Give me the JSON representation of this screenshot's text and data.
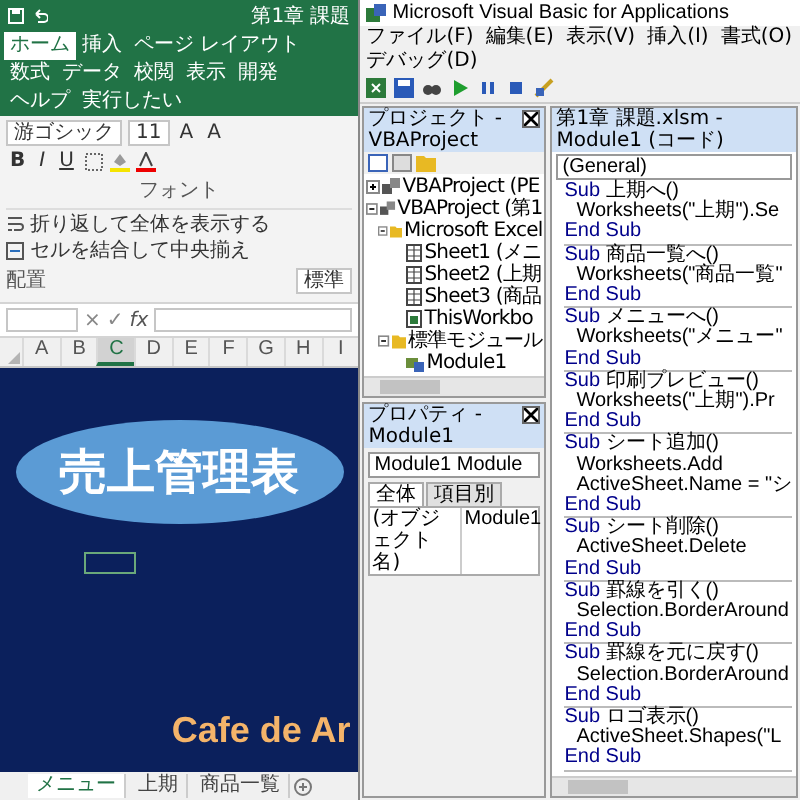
{
  "excel": {
    "title": "第1章 課題",
    "ribbon_tabs": [
      {
        "label": "ホーム",
        "selected": true
      },
      {
        "label": "挿入",
        "selected": false
      },
      {
        "label": "ページ レイアウト",
        "selected": false
      },
      {
        "label": "数式",
        "selected": false
      },
      {
        "label": "データ",
        "selected": false
      },
      {
        "label": "校閲",
        "selected": false
      },
      {
        "label": "表示",
        "selected": false
      },
      {
        "label": "開発",
        "selected": false
      },
      {
        "label": "ヘルプ",
        "selected": false
      },
      {
        "label": "実行したい",
        "selected": false
      }
    ],
    "font": {
      "name": "游ゴシック",
      "size": "11",
      "size_buttons": [
        "A",
        "A"
      ],
      "style_buttons": [
        "B",
        "I",
        "U"
      ],
      "label": "フォント"
    },
    "alignment": {
      "wrap_text": "折り返して全体を表示する",
      "merge_center": "セルを結合して中央揃え",
      "label": "配置"
    },
    "number_format": "標準",
    "formula_bar": {
      "cancel": "×",
      "enter": "✓",
      "function": "fx"
    },
    "columns": [
      {
        "label": "A",
        "selected": false
      },
      {
        "label": "B",
        "selected": false
      },
      {
        "label": "C",
        "selected": true
      },
      {
        "label": "D",
        "selected": false
      },
      {
        "label": "E",
        "selected": false
      },
      {
        "label": "F",
        "selected": false
      },
      {
        "label": "G",
        "selected": false
      },
      {
        "label": "H",
        "selected": false
      },
      {
        "label": "I",
        "selected": false
      }
    ],
    "sheet": {
      "title": "売上管理表",
      "brand": "Cafe de Ar"
    },
    "sheet_tabs": [
      {
        "label": "メニュー",
        "selected": true
      },
      {
        "label": "上期",
        "selected": false
      },
      {
        "label": "商品一覧",
        "selected": false
      }
    ]
  },
  "vbe": {
    "title": "Microsoft Visual Basic for Applications",
    "menu": [
      "ファイル(F)",
      "編集(E)",
      "表示(V)",
      "挿入(I)",
      "書式(O)",
      "デバッグ(D)"
    ],
    "project": {
      "title": "プロジェクト - VBAProject",
      "tree": [
        {
          "label": "VBAProject (PE",
          "kind": "project",
          "expanded": false
        },
        {
          "label": "VBAProject (第1",
          "kind": "project",
          "expanded": true,
          "children": [
            {
              "label": "Microsoft Excel",
              "kind": "folder",
              "expanded": true,
              "children": [
                {
                  "label": "Sheet1 (メニ",
                  "kind": "sheet"
                },
                {
                  "label": "Sheet2 (上期",
                  "kind": "sheet"
                },
                {
                  "label": "Sheet3 (商品",
                  "kind": "sheet"
                },
                {
                  "label": "ThisWorkbo",
                  "kind": "workbook"
                }
              ]
            },
            {
              "label": "標準モジュール",
              "kind": "folder",
              "expanded": true,
              "children": [
                {
                  "label": "Module1",
                  "kind": "module"
                }
              ]
            }
          ]
        }
      ]
    },
    "properties": {
      "title": "プロパティ - Module1",
      "object": "Module1 Module",
      "tabs": [
        {
          "label": "全体",
          "selected": true
        },
        {
          "label": "項目別",
          "selected": false
        }
      ],
      "rows": [
        {
          "name": "(オブジェクト名)",
          "value": "Module1"
        }
      ]
    },
    "code": {
      "title": "第1章 課題.xlsm - Module1 (コード)",
      "object": "(General)",
      "procedures": [
        {
          "keyword": "Sub",
          "name": "上期へ()",
          "body": [
            "Worksheets(\"上期\").Se"
          ],
          "end": "End Sub"
        },
        {
          "keyword": "Sub",
          "name": "商品一覧へ()",
          "body": [
            "Worksheets(\"商品一覧\""
          ],
          "end": "End Sub"
        },
        {
          "keyword": "Sub",
          "name": "メニューへ()",
          "body": [
            "Worksheets(\"メニュー\""
          ],
          "end": "End Sub"
        },
        {
          "keyword": "Sub",
          "name": "印刷プレビュー()",
          "body": [
            "Worksheets(\"上期\").Pr"
          ],
          "end": "End Sub"
        },
        {
          "keyword": "Sub",
          "name": "シート追加()",
          "body": [
            "Worksheets.Add",
            "ActiveSheet.Name = \"シ"
          ],
          "end": "End Sub"
        },
        {
          "keyword": "Sub",
          "name": "シート削除()",
          "body": [
            "ActiveSheet.Delete"
          ],
          "end": "End Sub"
        },
        {
          "keyword": "Sub",
          "name": "罫線を引く()",
          "body": [
            "Selection.BorderAround"
          ],
          "end": "End Sub"
        },
        {
          "keyword": "Sub",
          "name": "罫線を元に戻す()",
          "body": [
            "Selection.BorderAround"
          ],
          "end": "End Sub"
        },
        {
          "keyword": "Sub",
          "name": "ロゴ表示()",
          "body": [
            "ActiveSheet.Shapes(\"L"
          ],
          "end": "End Sub"
        }
      ]
    }
  }
}
